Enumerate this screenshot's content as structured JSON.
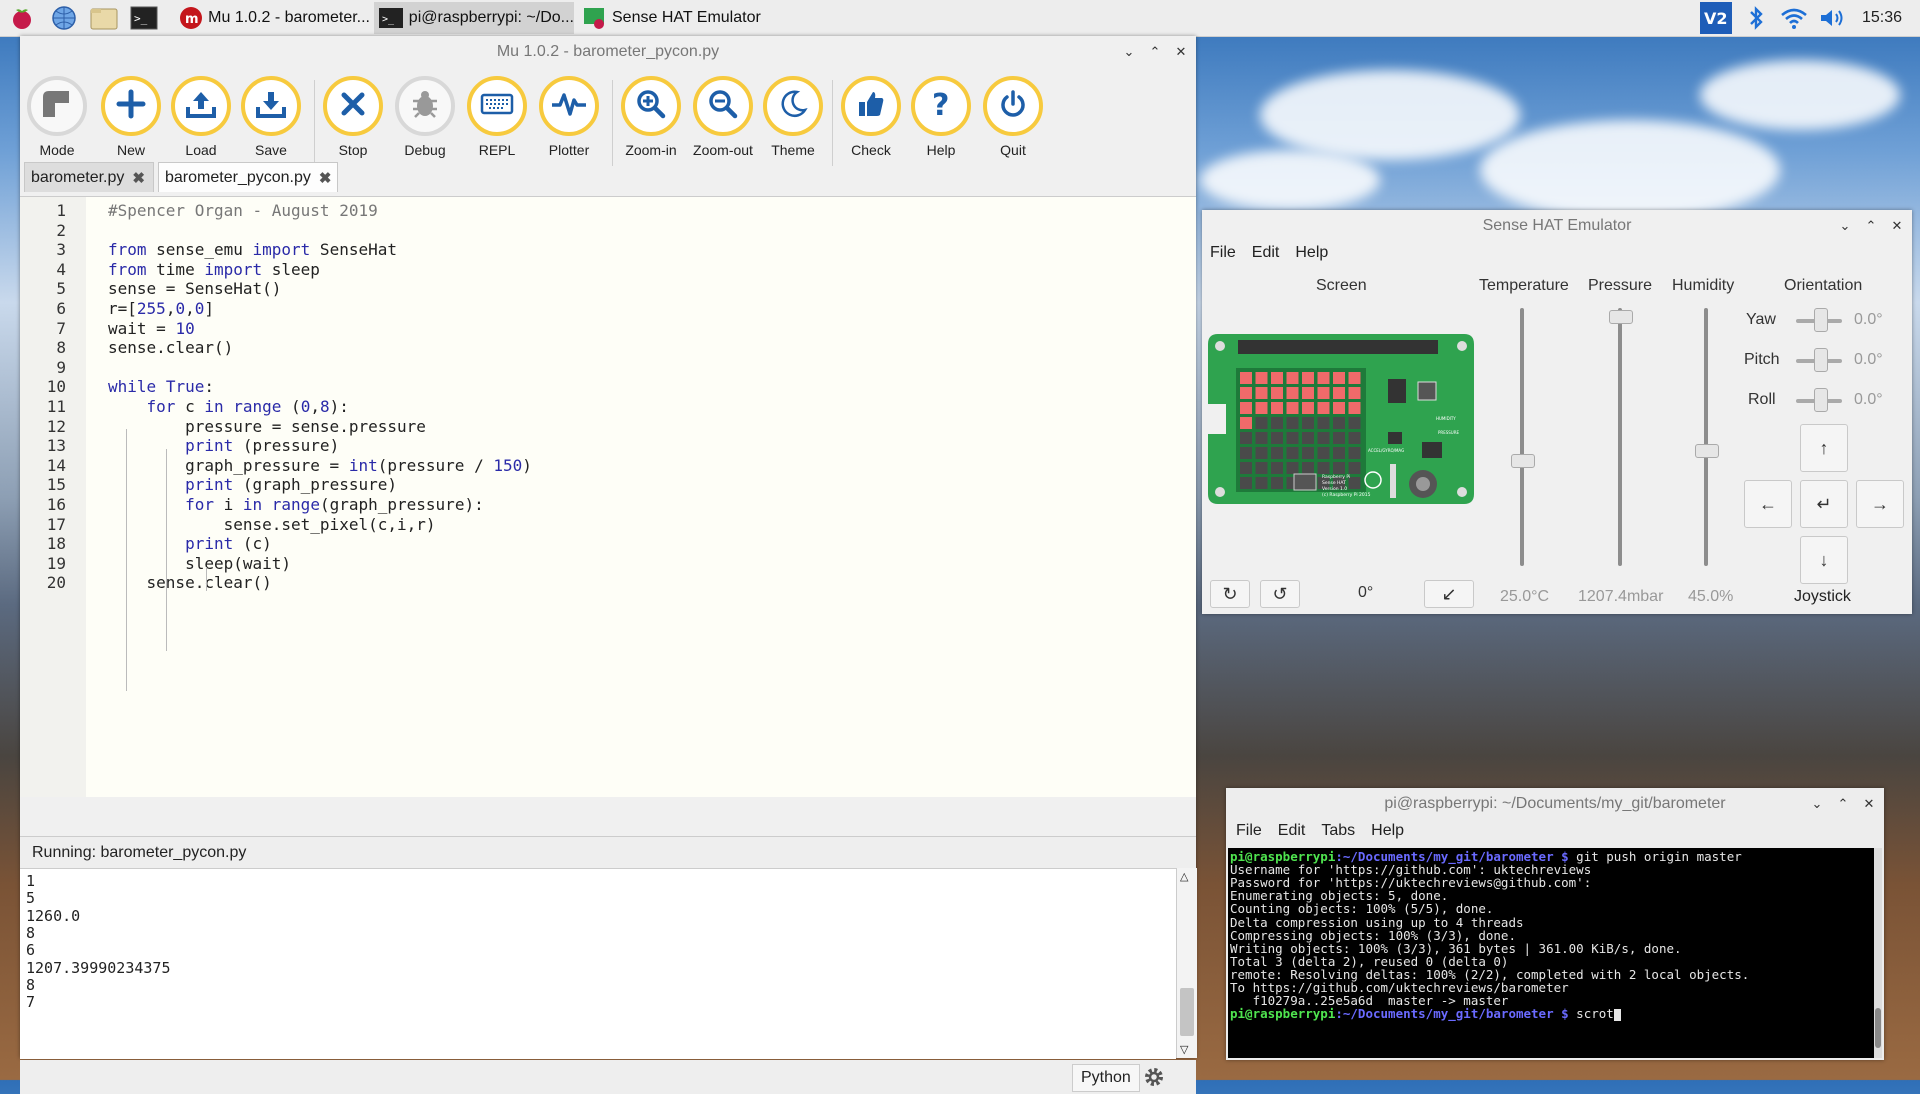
{
  "taskbar": {
    "tasks": [
      {
        "label": "Mu 1.0.2 - barometer..."
      },
      {
        "label": "pi@raspberrypi: ~/Do..."
      },
      {
        "label": "Sense HAT Emulator"
      }
    ],
    "clock": "15:36"
  },
  "mu": {
    "title": "Mu 1.0.2 - barometer_pycon.py",
    "toolbar": [
      {
        "label": "Mode",
        "icon": "mode-icon"
      },
      {
        "label": "New",
        "icon": "plus-icon"
      },
      {
        "label": "Load",
        "icon": "upload-icon"
      },
      {
        "label": "Save",
        "icon": "download-icon"
      },
      {
        "label": "Stop",
        "icon": "close-icon"
      },
      {
        "label": "Debug",
        "icon": "bug-icon"
      },
      {
        "label": "REPL",
        "icon": "keyboard-icon"
      },
      {
        "label": "Plotter",
        "icon": "pulse-icon"
      },
      {
        "label": "Zoom-in",
        "icon": "zoom-in-icon"
      },
      {
        "label": "Zoom-out",
        "icon": "zoom-out-icon"
      },
      {
        "label": "Theme",
        "icon": "moon-icon"
      },
      {
        "label": "Check",
        "icon": "thumbs-up-icon"
      },
      {
        "label": "Help",
        "icon": "question-icon"
      },
      {
        "label": "Quit",
        "icon": "power-icon"
      }
    ],
    "tabs": [
      {
        "label": "barometer.py"
      },
      {
        "label": "barometer_pycon.py"
      }
    ],
    "line_numbers": [
      "1",
      "2",
      "3",
      "4",
      "5",
      "6",
      "7",
      "8",
      "9",
      "10",
      "11",
      "12",
      "13",
      "14",
      "15",
      "16",
      "17",
      "18",
      "19",
      "20"
    ],
    "code": [
      "#Spencer Organ - August 2019",
      "",
      "from sense_emu import SenseHat",
      "from time import sleep",
      "sense = SenseHat()",
      "r=[255,0,0]",
      "wait = 10",
      "sense.clear()",
      "",
      "while True:",
      "    for c in range (0,8):",
      "        pressure = sense.pressure",
      "        print (pressure)",
      "        graph_pressure = int(pressure / 150)",
      "        print (graph_pressure)",
      "        for i in range(graph_pressure):",
      "            sense.set_pixel(c,i,r)",
      "        print (c)",
      "        sleep(wait)",
      "    sense.clear()"
    ],
    "running_label": "Running: barometer_pycon.py",
    "repl_output": [
      "1",
      "5",
      "1260.0",
      "8",
      "6",
      "1207.39990234375",
      "8",
      "7"
    ],
    "status_mode": "Python"
  },
  "sensehat": {
    "title": "Sense HAT Emulator",
    "menu": [
      "File",
      "Edit",
      "Help"
    ],
    "headers": {
      "screen": "Screen",
      "temperature": "Temperature",
      "pressure": "Pressure",
      "humidity": "Humidity",
      "orientation": "Orientation"
    },
    "rotation": "0°",
    "temperature_value": "25.0°C",
    "pressure_value": "1207.4mbar",
    "humidity_value": "45.0%",
    "orientation": [
      {
        "label": "Yaw",
        "value": "0.0°"
      },
      {
        "label": "Pitch",
        "value": "0.0°"
      },
      {
        "label": "Roll",
        "value": "0.0°"
      }
    ],
    "levels": {
      "temperature": 0.41,
      "pressure": 0.97,
      "humidity": 0.45
    },
    "joystick_label": "Joystick",
    "board_text": {
      "humidity": "HUMIDITY",
      "accel": "ACCEL/GYRO/MAG",
      "pressure": "PRESSURE",
      "brand": "Raspberry Pi",
      "product": "Sense HAT",
      "version": "Version 1.0",
      "copyright": "(c) Raspberry Pi 2015"
    }
  },
  "terminal": {
    "title": "pi@raspberrypi: ~/Documents/my_git/barometer",
    "menu": [
      "File",
      "Edit",
      "Tabs",
      "Help"
    ],
    "prompt_user": "pi@raspberrypi",
    "prompt_path": ":~/Documents/my_git/barometer $",
    "first_cmd": " git push origin master",
    "lines": [
      "Username for 'https://github.com': uktechreviews",
      "Password for 'https://uktechreviews@github.com':",
      "Enumerating objects: 5, done.",
      "Counting objects: 100% (5/5), done.",
      "Delta compression using up to 4 threads",
      "Compressing objects: 100% (3/3), done.",
      "Writing objects: 100% (3/3), 361 bytes | 361.00 KiB/s, done.",
      "Total 3 (delta 2), reused 0 (delta 0)",
      "remote: Resolving deltas: 100% (2/2), completed with 2 local objects.",
      "To https://github.com/uktechreviews/barometer",
      "   f10279a..25e5a6d  master -> master"
    ],
    "last_cmd": " scrot"
  },
  "colors": {
    "accent": "#f7ca3e",
    "led_red": "#f06a6a",
    "board_green": "#2fa34f"
  }
}
